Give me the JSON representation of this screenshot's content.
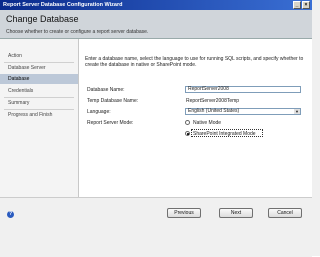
{
  "window": {
    "title": "Report Server Database Configuration Wizard"
  },
  "header": {
    "title": "Change Database",
    "subtitle": "Choose whether to create or configure a report server database."
  },
  "sidebar": {
    "items": [
      {
        "label": "Action",
        "selected": false
      },
      {
        "label": "Database Server",
        "selected": false
      },
      {
        "label": "Database",
        "selected": true
      },
      {
        "label": "Credentials",
        "selected": false
      },
      {
        "label": "Summary",
        "selected": false
      },
      {
        "label": "Progress and Finish",
        "selected": false
      }
    ]
  },
  "main": {
    "intro": "Enter a database name, select the language to use for running SQL scripts, and specify whether to create the database in native or SharePoint mode.",
    "database_name_label": "Database Name:",
    "database_name_value": "ReportServer2008",
    "temp_db_label": "Temp Database Name:",
    "temp_db_value": "ReportServer2008Temp",
    "language_label": "Language:",
    "language_value": "English (United States)",
    "mode_label": "Report Server Mode:",
    "mode_native": "Native Mode",
    "mode_sharepoint": "SharePoint Integrated Mode",
    "selected_mode": "SharePoint Integrated Mode"
  },
  "footer": {
    "previous_label": "Previous",
    "next_label": "Next",
    "cancel_label": "Cancel"
  },
  "icons": {
    "help": "help-icon",
    "minimize": "minimize-icon",
    "close": "close-icon"
  },
  "colors": {
    "titlebar": "#0a2a8c",
    "selected_item": "#bcc8d8"
  }
}
